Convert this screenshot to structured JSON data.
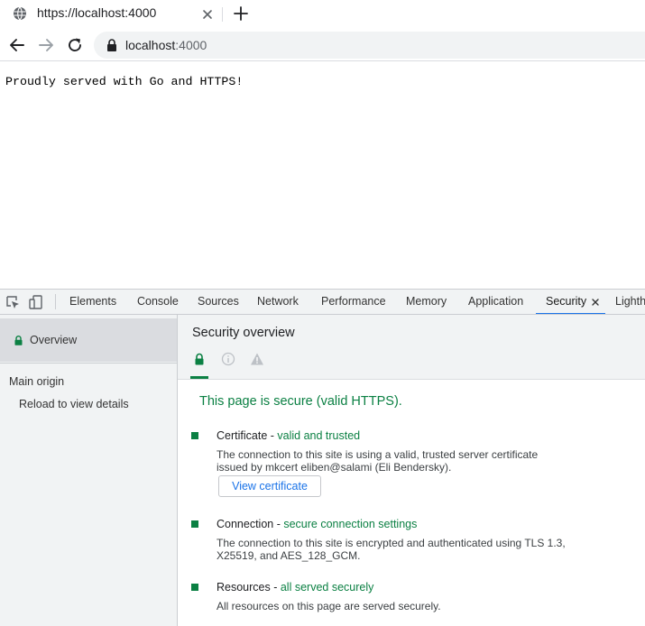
{
  "browser": {
    "tab_title": "https://localhost:4000",
    "url_host": "localhost",
    "url_port": ":4000"
  },
  "page": {
    "text": "Proudly served with Go and HTTPS!"
  },
  "devtools": {
    "tabs": [
      "Elements",
      "Console",
      "Sources",
      "Network",
      "Performance",
      "Memory",
      "Application",
      "Security",
      "Lighthouse"
    ],
    "active_tab": "Security",
    "sidebar": {
      "overview_label": "Overview",
      "main_origin": "Main origin",
      "reload_text": "Reload to view details"
    },
    "overview": {
      "title": "Security overview",
      "summary": "This page is secure (valid HTTPS).",
      "certificate": {
        "label": "Certificate - ",
        "status": "valid and trusted",
        "desc_line1": "The connection to this site is using a valid, trusted server certificate",
        "desc_line2": "issued by mkcert eliben@salami (Eli Bendersky).",
        "button": "View certificate"
      },
      "connection": {
        "label": "Connection - ",
        "status": "secure connection settings",
        "desc_line1": "The connection to this site is encrypted and authenticated using TLS 1.3,",
        "desc_line2": "X25519, and AES_128_GCM."
      },
      "resources": {
        "label": "Resources - ",
        "status": "all served securely",
        "desc_line1": "All resources on this page are served securely."
      }
    }
  },
  "colors": {
    "secure_green": "#0b8043",
    "active_tab_blue": "#1a73e8",
    "link_blue": "#1a73e8"
  }
}
